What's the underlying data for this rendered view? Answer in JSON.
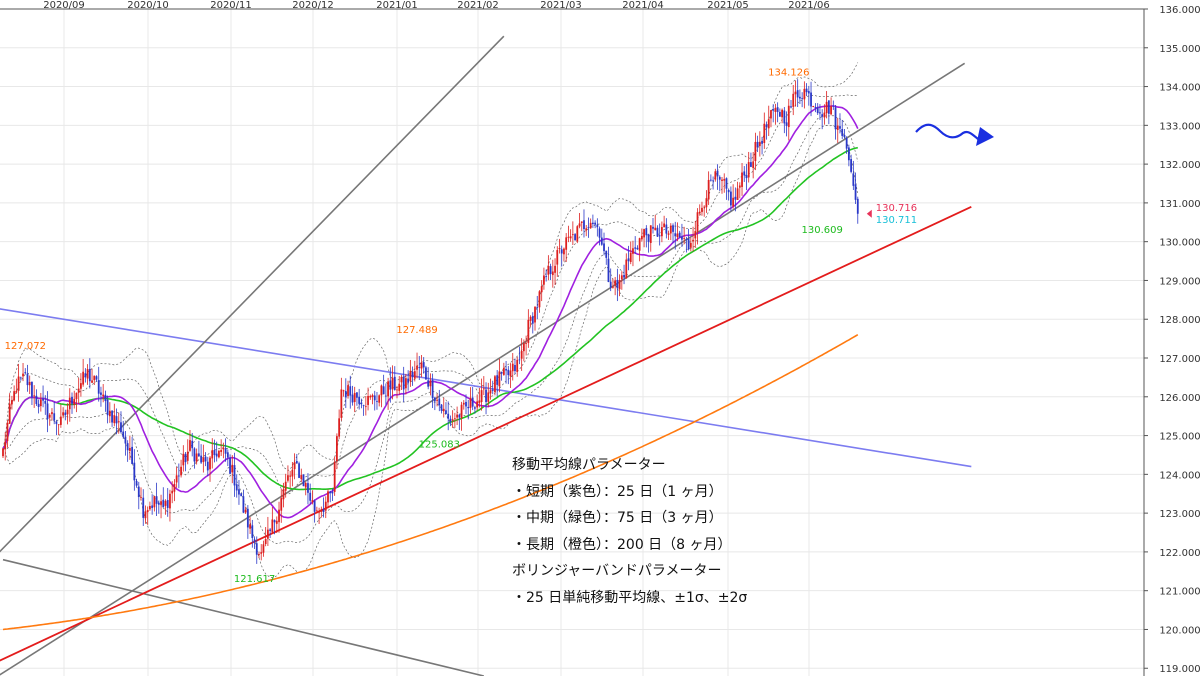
{
  "chart_data": {
    "type": "candlestick",
    "x_ticks": [
      "2020/09",
      "2020/10",
      "2020/11",
      "2020/12",
      "2021/01",
      "2021/02",
      "2021/03",
      "2021/04",
      "2021/05",
      "2021/06"
    ],
    "y_ticks": [
      "119.000",
      "120.000",
      "121.000",
      "122.000",
      "123.000",
      "124.000",
      "125.000",
      "126.000",
      "127.000",
      "128.000",
      "129.000",
      "130.000",
      "131.000",
      "132.000",
      "133.000",
      "134.000",
      "135.000",
      "136.000"
    ],
    "ylim": [
      118.8,
      136.0
    ],
    "grid": true,
    "colors": {
      "up": "#dd1f1f",
      "down": "#2a38c8",
      "ma_short": "#a020e0",
      "ma_mid": "#22c322",
      "ma_long": "#ff7a10",
      "trend_red": "#e31c1c",
      "trend_gray": "#777777",
      "trend_blue": "#7c7cf0",
      "bands": "#666666"
    },
    "close_path": [
      [
        0,
        124.6
      ],
      [
        3,
        125.6
      ],
      [
        6,
        126.3
      ],
      [
        10,
        126.5
      ],
      [
        14,
        126.0
      ],
      [
        20,
        125.6
      ],
      [
        26,
        125.3
      ],
      [
        32,
        126.1
      ],
      [
        38,
        126.6
      ],
      [
        42,
        126.3
      ],
      [
        45,
        125.9
      ],
      [
        48,
        125.6
      ],
      [
        53,
        125.2
      ],
      [
        58,
        124.3
      ],
      [
        63,
        123.1
      ],
      [
        68,
        123.3
      ],
      [
        72,
        123.1
      ],
      [
        76,
        123.6
      ],
      [
        80,
        124.2
      ],
      [
        84,
        124.7
      ],
      [
        88,
        124.4
      ],
      [
        92,
        124.2
      ],
      [
        96,
        124.6
      ],
      [
        100,
        124.5
      ],
      [
        104,
        123.9
      ],
      [
        108,
        123.1
      ],
      [
        112,
        122.4
      ],
      [
        116,
        121.9
      ],
      [
        120,
        122.5
      ],
      [
        124,
        123.2
      ],
      [
        128,
        123.9
      ],
      [
        132,
        124.2
      ],
      [
        136,
        123.7
      ],
      [
        140,
        123.1
      ],
      [
        144,
        123.2
      ],
      [
        148,
        123.5
      ],
      [
        152,
        126.2
      ],
      [
        156,
        126.1
      ],
      [
        160,
        126.0
      ],
      [
        164,
        125.9
      ],
      [
        168,
        126.0
      ],
      [
        172,
        126.2
      ],
      [
        176,
        126.3
      ],
      [
        180,
        126.3
      ],
      [
        184,
        126.6
      ],
      [
        188,
        126.8
      ],
      [
        192,
        126.3
      ],
      [
        196,
        125.8
      ],
      [
        200,
        125.4
      ],
      [
        204,
        125.5
      ],
      [
        208,
        125.7
      ],
      [
        212,
        125.9
      ],
      [
        216,
        126.0
      ],
      [
        220,
        126.3
      ],
      [
        224,
        126.5
      ],
      [
        228,
        126.6
      ],
      [
        232,
        126.9
      ],
      [
        236,
        127.8
      ],
      [
        240,
        128.4
      ],
      [
        244,
        129.1
      ],
      [
        248,
        129.5
      ],
      [
        252,
        129.9
      ],
      [
        256,
        130.1
      ],
      [
        260,
        130.4
      ],
      [
        264,
        130.6
      ],
      [
        268,
        130.3
      ],
      [
        272,
        129.1
      ],
      [
        276,
        128.8
      ],
      [
        280,
        129.4
      ],
      [
        284,
        129.9
      ],
      [
        288,
        130.2
      ],
      [
        292,
        130.2
      ],
      [
        296,
        130.3
      ],
      [
        300,
        130.2
      ],
      [
        304,
        130.1
      ],
      [
        308,
        129.9
      ],
      [
        312,
        130.6
      ],
      [
        316,
        131.3
      ],
      [
        320,
        131.6
      ],
      [
        324,
        131.4
      ],
      [
        328,
        131.0
      ],
      [
        332,
        131.6
      ],
      [
        336,
        132.1
      ],
      [
        340,
        132.6
      ],
      [
        344,
        133.1
      ],
      [
        348,
        133.4
      ],
      [
        352,
        133.2
      ],
      [
        356,
        133.8
      ],
      [
        360,
        133.9
      ],
      [
        364,
        133.6
      ],
      [
        368,
        133.4
      ],
      [
        372,
        133.5
      ],
      [
        375,
        132.9
      ],
      [
        378,
        132.7
      ],
      [
        381,
        131.8
      ],
      [
        384,
        130.72
      ]
    ],
    "last_index": 384,
    "ma_short_period": 25,
    "ma_mid_period": 75,
    "ma_long_start": 120.0,
    "ma_long_end": 127.6,
    "trend_red": [
      [
        -20,
        118.7
      ],
      [
        435,
        130.9
      ]
    ],
    "trend_gray_up": [
      [
        -5,
        121.8
      ],
      [
        225,
        135.3
      ]
    ],
    "trend_gray_mid": [
      [
        -5,
        118.7
      ],
      [
        432,
        134.6
      ]
    ],
    "trend_gray_down": [
      [
        0,
        121.8
      ],
      [
        216,
        118.8
      ]
    ],
    "trend_blue": [
      [
        -5,
        128.3
      ],
      [
        435,
        124.2
      ]
    ],
    "annotations": [
      {
        "text": "127.072",
        "x": 10,
        "y": 127.072,
        "color": "#ff6a00",
        "pos": "above"
      },
      {
        "text": "127.489",
        "x": 186,
        "y": 127.489,
        "color": "#ff6a00",
        "pos": "above"
      },
      {
        "text": "134.126",
        "x": 353,
        "y": 134.126,
        "color": "#ff6a00",
        "pos": "above"
      },
      {
        "text": "121.617",
        "x": 113,
        "y": 121.617,
        "color": "#1dbb1d",
        "pos": "below"
      },
      {
        "text": "125.083",
        "x": 196,
        "y": 125.083,
        "color": "#1dbb1d",
        "pos": "below"
      },
      {
        "text": "130.609",
        "x": 368,
        "y": 130.609,
        "color": "#1dbb1d",
        "pos": "below"
      }
    ],
    "price_labels": [
      {
        "text": "130.716",
        "color": "#e8335a"
      },
      {
        "text": "130.711",
        "color": "#19c0d8"
      }
    ],
    "legend_lines": [
      "移動平均線パラメーター",
      "・短期（紫色）：25 日（1 ヶ月）",
      "・中期（緑色）：75 日（3 ヶ月）",
      "・長期（橙色）：200 日（8 ヶ月）",
      "ボリンジャーバンドパラメーター",
      "・25 日単純移動平均線、±1σ、±2σ"
    ]
  }
}
